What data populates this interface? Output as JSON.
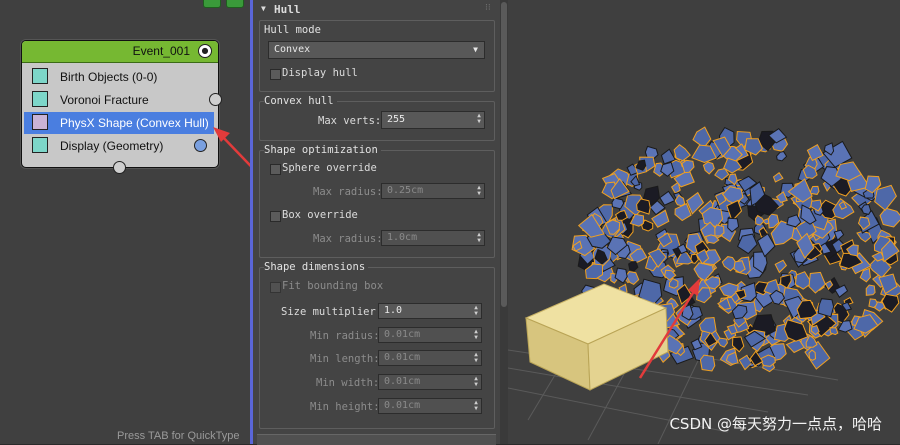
{
  "graph": {
    "event": {
      "title": "Event_001",
      "operators": [
        {
          "label": "Birth Objects (0-0)",
          "icon": "birth-objects-icon"
        },
        {
          "label": "Voronoi Fracture",
          "icon": "voronoi-icon"
        },
        {
          "label": "PhysX Shape (Convex Hull)",
          "icon": "physx-shape-icon",
          "selected": true
        },
        {
          "label": "Display (Geometry)",
          "icon": "display-icon"
        }
      ]
    },
    "hint": "Press TAB for QuickType"
  },
  "panel": {
    "rollout_title": "Hull",
    "hull_mode": {
      "label": "Hull mode",
      "value": "Convex",
      "display_hull": "Display hull"
    },
    "convex_hull": {
      "title": "Convex hull",
      "max_verts_label": "Max verts:",
      "max_verts": "255"
    },
    "shape_optimization": {
      "title": "Shape optimization",
      "sphere_override": "Sphere override",
      "max_radius_label": "Max radius:",
      "max_radius": "0.25cm",
      "box_override": "Box override",
      "box_max_radius_label": "Max radius:",
      "box_max_radius": "1.0cm"
    },
    "shape_dimensions": {
      "title": "Shape dimensions",
      "fit_bounding_box": "Fit bounding box",
      "size_multiplier_label": "Size multiplier:",
      "size_multiplier": "1.0",
      "min_radius_label": "Min radius:",
      "min_radius": "0.01cm",
      "min_length_label": "Min length:",
      "min_length": "0.01cm",
      "min_width_label": "Min width:",
      "min_width": "0.01cm",
      "min_height_label": "Min height:",
      "min_height": "0.01cm"
    }
  },
  "viewport": {
    "watermark": "CSDN @每天努力一点点，哈哈"
  },
  "colors": {
    "node_header": "#76b832",
    "selected_row": "#4a7ee0",
    "arrow": "#e23b3b",
    "shard_face": "#5a73b5",
    "shard_edge": "#f0a020",
    "box": "#e7d590"
  }
}
